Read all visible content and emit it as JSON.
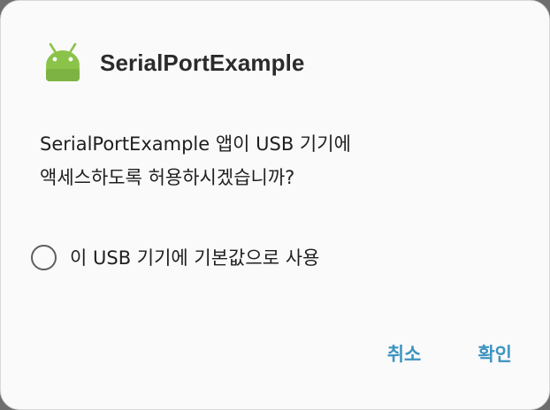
{
  "dialog": {
    "app_icon": "android-robot-icon",
    "title": "SerialPortExample",
    "message": "SerialPortExample 앱이 USB 기기에\n액세스하도록 허용하시겠습니까?",
    "default_checkbox": {
      "label": "이 USB 기기에 기본값으로 사용",
      "checked": false
    },
    "buttons": {
      "cancel_label": "취소",
      "ok_label": "확인"
    }
  },
  "colors": {
    "accent": "#3e94c0",
    "icon_green": "#8bc34a"
  }
}
